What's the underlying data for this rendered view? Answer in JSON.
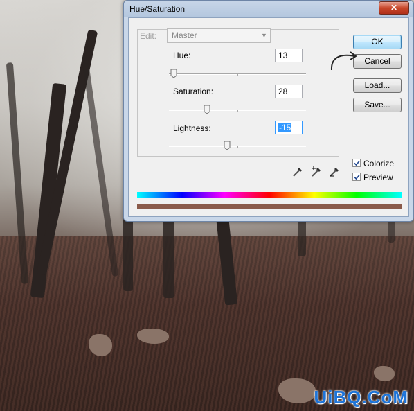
{
  "dialog": {
    "title": "Hue/Saturation",
    "close_glyph": "✕",
    "edit_label": "Edit:",
    "edit_value": "Master",
    "hue": {
      "label": "Hue:",
      "value": "13",
      "level": 0.036
    },
    "saturation": {
      "label": "Saturation:",
      "value": "28",
      "level": 0.28
    },
    "lightness": {
      "label": "Lightness:",
      "value": "-15",
      "level": 0.425
    },
    "buttons": {
      "ok": "OK",
      "cancel": "Cancel",
      "load": "Load...",
      "save": "Save..."
    },
    "colorize": {
      "label": "Colorize",
      "checked": true
    },
    "preview": {
      "label": "Preview",
      "checked": true
    },
    "icons": [
      "eyedropper-icon",
      "eyedropper-plus-icon",
      "eyedropper-minus-icon"
    ],
    "result_color": "#8a5a4a"
  },
  "watermark": "UiBQ.CoM"
}
